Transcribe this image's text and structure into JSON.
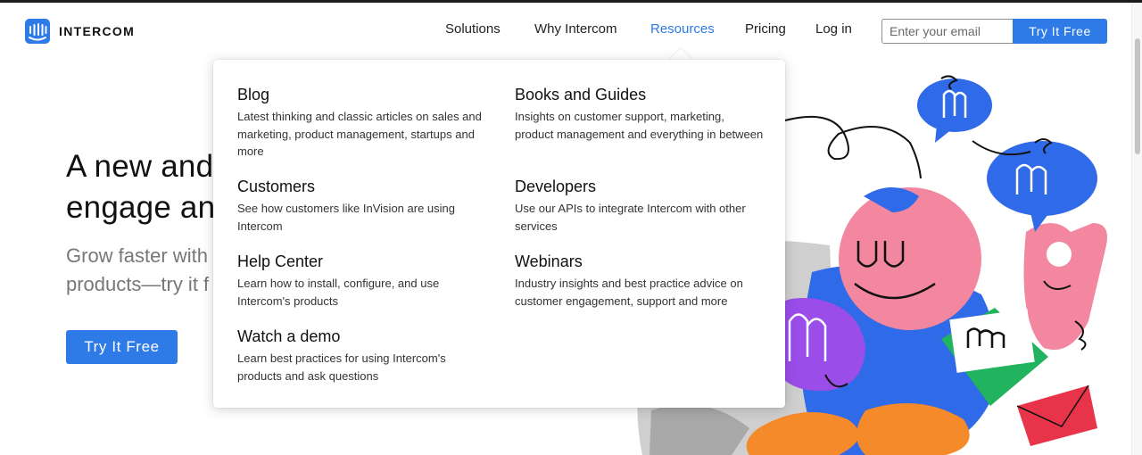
{
  "brand": {
    "name": "INTERCOM",
    "logo_icon": "intercom-logo-icon",
    "color": "#2e7be8"
  },
  "nav": {
    "items": [
      {
        "label": "Solutions",
        "active": false
      },
      {
        "label": "Why Intercom",
        "active": false
      },
      {
        "label": "Resources",
        "active": true
      },
      {
        "label": "Pricing",
        "active": false
      },
      {
        "label": "Log in",
        "active": false
      }
    ],
    "email_placeholder": "Enter your email",
    "cta_label": "Try It Free"
  },
  "hero": {
    "title_line1": "A new and",
    "title_line2": "engage and",
    "subtitle_line1": "Grow faster with",
    "subtitle_line2": "products—try it f",
    "cta_label": "Try It Free"
  },
  "resources_menu": {
    "left": [
      {
        "title": "Blog",
        "desc": "Latest thinking and classic articles on sales and marketing, product management, startups and more"
      },
      {
        "title": "Customers",
        "desc": "See how customers like InVision are using Intercom"
      },
      {
        "title": "Help Center",
        "desc": "Learn how to install, configure, and use Intercom's products"
      },
      {
        "title": "Watch a demo",
        "desc": "Learn best practices for using Intercom's products and ask questions"
      }
    ],
    "right": [
      {
        "title": "Books and Guides",
        "desc": "Insights on customer support, marketing, product management and everything in between"
      },
      {
        "title": "Developers",
        "desc": "Use our APIs to integrate Intercom with other services"
      },
      {
        "title": "Webinars",
        "desc": "Industry insights and best practice advice on customer engagement, support and more"
      }
    ]
  },
  "colors": {
    "accent": "#2e7be8",
    "pink": "#f08db0",
    "purple": "#9b4dea",
    "green": "#22b35e",
    "red": "#e8344a",
    "orange": "#f48a2a"
  }
}
